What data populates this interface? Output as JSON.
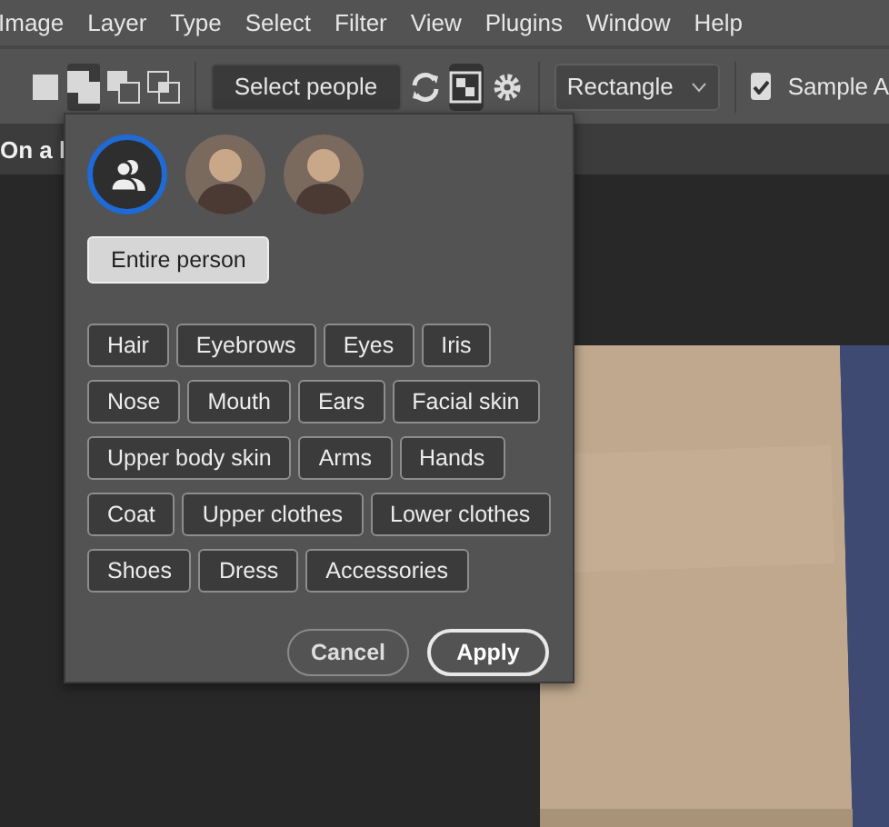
{
  "menu": [
    "Image",
    "Layer",
    "Type",
    "Select",
    "Filter",
    "View",
    "Plugins",
    "Window",
    "Help"
  ],
  "toolbar": {
    "modes": [
      {
        "kind": "new",
        "selected": false
      },
      {
        "kind": "add",
        "selected": true
      },
      {
        "kind": "subtract",
        "selected": false
      },
      {
        "kind": "intersect",
        "selected": false
      }
    ],
    "select_people": "Select people",
    "mask_toggle": {
      "on": true
    },
    "shape": "Rectangle",
    "sample": {
      "label": "Sample A",
      "checked": true
    }
  },
  "document_tab": "On a l",
  "popup": {
    "avatars": [
      {
        "kind": "group",
        "selected": true
      },
      {
        "kind": "person",
        "selected": false
      },
      {
        "kind": "person",
        "selected": false
      }
    ],
    "entire_person": {
      "label": "Entire person",
      "selected": true
    },
    "part_rows": [
      [
        "Hair",
        "Eyebrows",
        "Eyes",
        "Iris"
      ],
      [
        "Nose",
        "Mouth",
        "Ears",
        "Facial skin"
      ],
      [
        "Upper body skin",
        "Arms",
        "Hands"
      ],
      [
        "Coat",
        "Upper clothes",
        "Lower clothes"
      ],
      [
        "Shoes",
        "Dress",
        "Accessories"
      ]
    ],
    "buttons": [
      {
        "label": "Cancel",
        "kind": "secondary"
      },
      {
        "label": "Apply",
        "kind": "primary"
      }
    ]
  }
}
